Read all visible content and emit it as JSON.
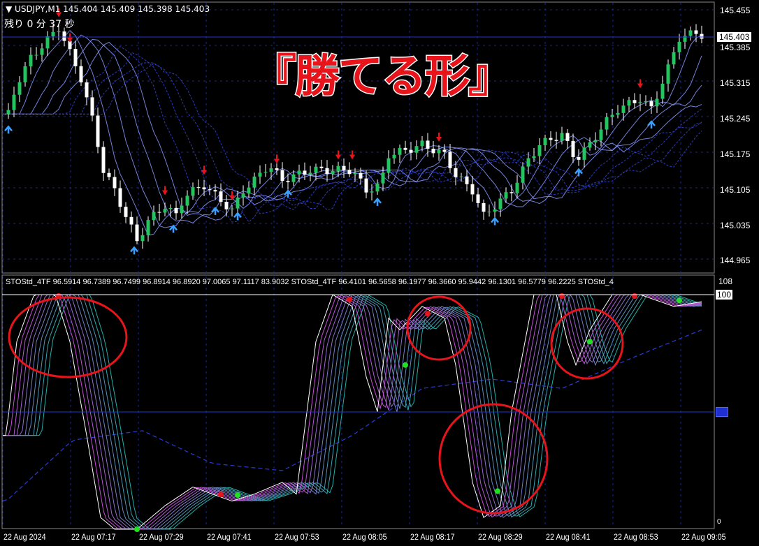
{
  "header": {
    "symbol_line": "▼ USDJPY,M1  145.404 145.409 145.398 145.403",
    "timer": "残り  0 分  37 秒"
  },
  "overlay_title": "『勝てる形』",
  "price_axis": {
    "ticks": [
      "145.455",
      "145.385",
      "145.315",
      "145.245",
      "145.175",
      "145.105",
      "145.035",
      "144.965"
    ],
    "current": "145.403"
  },
  "indicator": {
    "header": "STOStd_4TF 96.5914 96.7389 96.7499 96.8914 96.8920 97.0065 97.1117 83.9032  STOStd_4TF 96.4101 96.5658 96.1977 96.3660 95.9442 96.1301 96.5779 96.2225  STOStd_4",
    "axis_max": "108",
    "axis_100": "100",
    "axis_min": "0"
  },
  "time_axis": [
    "22 Aug 2024",
    "22 Aug 07:17",
    "22 Aug 07:29",
    "22 Aug 07:41",
    "22 Aug 07:53",
    "22 Aug 08:05",
    "22 Aug 08:17",
    "22 Aug 08:29",
    "22 Aug 08:41",
    "22 Aug 08:53",
    "22 Aug 09:05"
  ],
  "colors": {
    "bull": "#22c55e",
    "bear": "#ffffff",
    "grid": "#1c2a8a",
    "circle": "#e8141b",
    "down_arrow": "#e8141b",
    "up_arrow": "#3aa0ff"
  },
  "chart_data": [
    {
      "type": "candlestick",
      "title": "USDJPY,M1",
      "ylim": [
        144.94,
        145.47
      ],
      "x_unit": "minutes from 07:05",
      "close_path": [
        [
          1,
          145.25
        ],
        [
          2.5,
          145.31
        ],
        [
          5,
          145.36
        ],
        [
          7.5,
          145.39
        ],
        [
          10,
          145.42
        ],
        [
          12,
          145.37
        ],
        [
          14,
          145.32
        ],
        [
          16,
          145.24
        ],
        [
          18,
          145.14
        ],
        [
          20,
          145.1
        ],
        [
          22,
          145.05
        ],
        [
          24,
          145.0
        ],
        [
          26,
          145.04
        ],
        [
          29,
          145.07
        ],
        [
          31,
          145.05
        ],
        [
          32.5,
          145.09
        ],
        [
          36,
          145.11
        ],
        [
          39,
          145.08
        ],
        [
          41,
          145.06
        ],
        [
          43,
          145.1
        ],
        [
          45,
          145.12
        ],
        [
          47.5,
          145.15
        ],
        [
          50,
          145.12
        ],
        [
          52.5,
          145.13
        ],
        [
          55,
          145.14
        ],
        [
          59,
          145.14
        ],
        [
          62.5,
          145.14
        ],
        [
          65,
          145.1
        ],
        [
          67.5,
          145.11
        ],
        [
          69,
          145.17
        ],
        [
          72.5,
          145.18
        ],
        [
          75,
          145.19
        ],
        [
          79,
          145.17
        ],
        [
          81,
          145.13
        ],
        [
          84,
          145.1
        ],
        [
          86,
          145.05
        ],
        [
          89,
          145.08
        ],
        [
          91,
          145.1
        ],
        [
          94,
          145.16
        ],
        [
          96,
          145.19
        ],
        [
          100,
          145.21
        ],
        [
          102.5,
          145.16
        ],
        [
          105,
          145.19
        ],
        [
          107.5,
          145.23
        ],
        [
          110,
          145.26
        ],
        [
          114,
          145.28
        ],
        [
          116,
          145.26
        ],
        [
          119,
          145.34
        ],
        [
          121,
          145.4
        ],
        [
          124,
          145.41
        ],
        [
          125.5,
          145.403
        ]
      ]
    },
    {
      "type": "line",
      "title": "STOStd_4TF",
      "ylim": [
        0,
        108
      ],
      "levels": [
        50,
        100
      ],
      "main_path": [
        [
          0.6,
          40
        ],
        [
          2.5,
          80
        ],
        [
          5.6,
          100
        ],
        [
          9.4,
          100
        ],
        [
          12,
          80
        ],
        [
          15,
          40
        ],
        [
          17.5,
          5
        ],
        [
          20,
          0
        ],
        [
          24,
          0
        ],
        [
          29,
          10
        ],
        [
          34,
          18
        ],
        [
          37.5,
          15
        ],
        [
          41,
          12
        ],
        [
          45,
          15
        ],
        [
          50,
          20
        ],
        [
          52.5,
          15
        ],
        [
          56,
          80
        ],
        [
          59,
          100
        ],
        [
          62.5,
          95
        ],
        [
          65,
          65
        ],
        [
          67,
          50
        ],
        [
          69,
          90
        ],
        [
          71,
          85
        ],
        [
          75,
          95
        ],
        [
          79,
          90
        ],
        [
          81,
          70
        ],
        [
          84,
          20
        ],
        [
          86,
          5
        ],
        [
          89,
          10
        ],
        [
          91,
          50
        ],
        [
          95,
          100
        ],
        [
          99,
          100
        ],
        [
          101,
          80
        ],
        [
          102.5,
          70
        ],
        [
          105,
          85
        ],
        [
          109,
          100
        ],
        [
          114,
          100
        ],
        [
          120,
          95
        ],
        [
          125,
          97
        ]
      ],
      "signal_path": [
        [
          0.6,
          12
        ],
        [
          12.5,
          38
        ],
        [
          25,
          42
        ],
        [
          37.5,
          28
        ],
        [
          50,
          25
        ],
        [
          62.5,
          40
        ],
        [
          75,
          60
        ],
        [
          87.5,
          64
        ],
        [
          100,
          60
        ],
        [
          112.5,
          73
        ],
        [
          125,
          85
        ]
      ]
    }
  ]
}
